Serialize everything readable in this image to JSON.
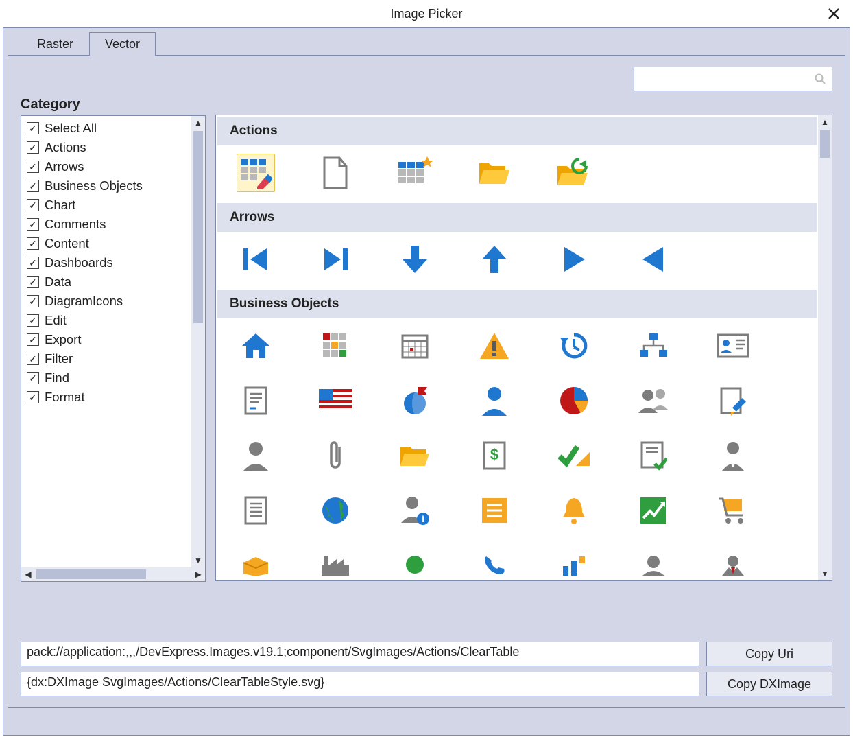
{
  "window": {
    "title": "Image Picker"
  },
  "tabs": {
    "raster": "Raster",
    "vector": "Vector",
    "active": "vector"
  },
  "search": {
    "value": "",
    "placeholder": ""
  },
  "category": {
    "label": "Category",
    "items": [
      "Select All",
      "Actions",
      "Arrows",
      "Business Objects",
      "Chart",
      "Comments",
      "Content",
      "Dashboards",
      "Data",
      "DiagramIcons",
      "Edit",
      "Export",
      "Filter",
      "Find",
      "Format"
    ]
  },
  "gallery": {
    "groups": {
      "actions": "Actions",
      "arrows": "Arrows",
      "business": "Business Objects"
    },
    "selected_icon": "clear-table-style"
  },
  "uri": {
    "value": "pack://application:,,,/DevExpress.Images.v19.1;component/SvgImages/Actions/ClearTable",
    "button": "Copy Uri"
  },
  "dximage": {
    "value": "{dx:DXImage SvgImages/Actions/ClearTableStyle.svg}",
    "button": "Copy DXImage"
  }
}
